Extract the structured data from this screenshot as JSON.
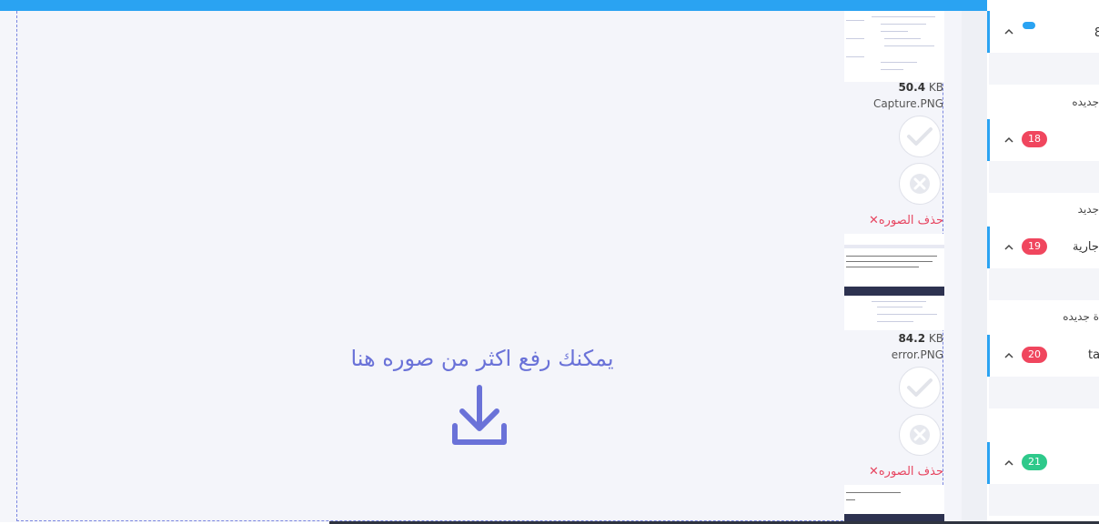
{
  "upload": {
    "drop_message": "يمكنك رفع اكثر من صوره هنا",
    "files": [
      {
        "size_value": "50.4",
        "size_unit": "KB",
        "name": "Capture.PNG",
        "remove_label": "حذف الصوره"
      },
      {
        "size_value": "84.2",
        "size_unit": "KB",
        "name": "error.PNG",
        "remove_label": "حذف الصوره"
      }
    ],
    "remove_symbol": "✕"
  },
  "sidebar": {
    "items": [
      {
        "label": "8",
        "badge": "",
        "badge_color": "#2aa3f2",
        "caption": "جديده"
      },
      {
        "label": "",
        "badge": "18",
        "badge_color": "#f0465e",
        "caption": "جديد"
      },
      {
        "label": "جارية",
        "badge": "19",
        "badge_color": "#f0465e",
        "caption": "ة جديده"
      },
      {
        "label": "ta",
        "badge": "20",
        "badge_color": "#f0465e",
        "caption": ""
      },
      {
        "label": "",
        "badge": "21",
        "badge_color": "#2ec98b",
        "caption": ""
      }
    ]
  },
  "colors": {
    "accent": "#2aa3f2",
    "drop": "#6a72d8",
    "danger": "#e74560"
  }
}
